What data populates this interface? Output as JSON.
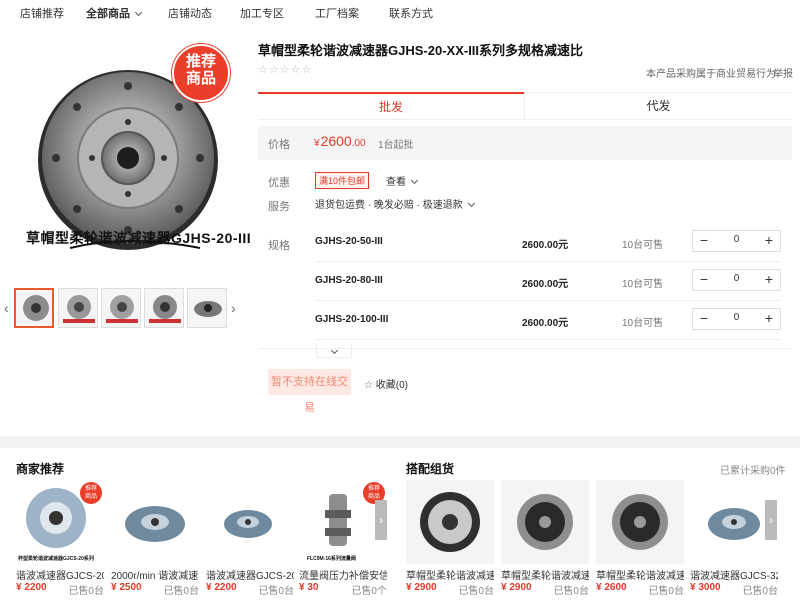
{
  "nav": {
    "items": [
      "店铺推荐",
      "全部商品",
      "店铺动态",
      "加工专区",
      "工厂档案",
      "联系方式"
    ]
  },
  "gallery": {
    "badge_line1": "推荐",
    "badge_line2": "商品",
    "caption": "草帽型柔轮谐波减速器GJHS-20-III"
  },
  "product": {
    "title": "草帽型柔轮谐波减速器GJHS-20-XX-III系列多规格减速比",
    "stars": "☆☆☆☆☆",
    "trade_note": "本产品采购属于商业贸易行为",
    "report": "举报"
  },
  "tabs": {
    "wholesale": "批发",
    "dropship": "代发"
  },
  "price": {
    "label": "价格",
    "currency": "¥",
    "integer": "2600",
    "decimal": ".00",
    "moq": "1台起批"
  },
  "promo": {
    "label": "优惠",
    "tag": "满10件包邮",
    "view": "查看"
  },
  "service": {
    "label": "服务",
    "text": "退货包运费 · 晚发必赔 · 极速退款"
  },
  "specs": {
    "label": "规格",
    "rows": [
      {
        "name": "GJHS-20-50-III",
        "price": "2600.00元",
        "stock": "10台可售",
        "qty": "0"
      },
      {
        "name": "GJHS-20-80-III",
        "price": "2600.00元",
        "stock": "10台可售",
        "qty": "0"
      },
      {
        "name": "GJHS-20-100-III",
        "price": "2600.00元",
        "stock": "10台可售",
        "qty": "0"
      }
    ]
  },
  "actions": {
    "no_trade": "暂不支持在线交易",
    "favorite": "收藏(0)"
  },
  "recommend": {
    "title": "商家推荐",
    "items": [
      {
        "name": "谐波减速器GJCS-20-...",
        "price": "¥ 2200",
        "sold": "已售0台"
      },
      {
        "name": "2000r/min 谐波减速...",
        "price": "¥ 2500",
        "sold": "已售0台"
      },
      {
        "name": "谐波减速器GJCS-20-...",
        "price": "¥ 2200",
        "sold": "已售0台"
      },
      {
        "name": "流量阀压力补偿安信...",
        "price": "¥ 30",
        "sold": "已售0个"
      }
    ],
    "first_caption": "杯型柔轮谐波减速器GJCS-20系列",
    "fourth_caption": "FLC9M-16系列流量阀"
  },
  "combo": {
    "title": "搭配组货",
    "count": "已累计采购0件",
    "items": [
      {
        "name": "草帽型柔轮谐波减速...",
        "price": "¥ 2900",
        "sold": "已售0台"
      },
      {
        "name": "草帽型柔轮谐波减速...",
        "price": "¥ 2900",
        "sold": "已售0台"
      },
      {
        "name": "草帽型柔轮谐波减速...",
        "price": "¥ 2600",
        "sold": "已售0台"
      },
      {
        "name": "谐波减速器GJCS-32-...",
        "price": "¥ 3000",
        "sold": "已售0台"
      }
    ]
  }
}
